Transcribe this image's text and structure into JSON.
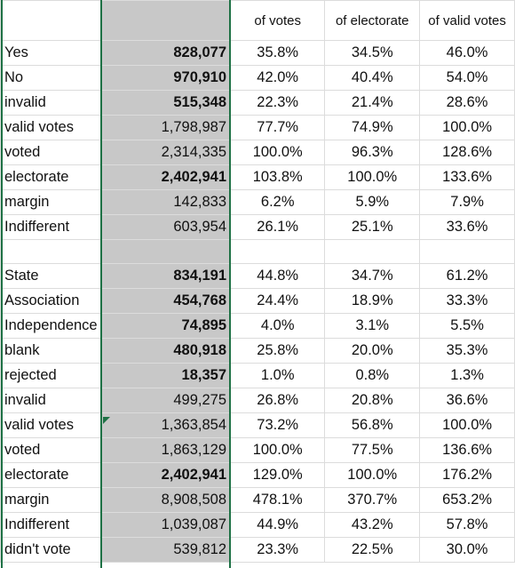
{
  "header": {
    "col_a": "",
    "col_b": "",
    "col_c": "of votes",
    "col_d": "of electorate",
    "col_e": "of valid votes"
  },
  "colors": {
    "selection_border": "#1e7145",
    "selected_fill": "#c8c8c8",
    "gridline": "#dcdcdc"
  },
  "rows": [
    {
      "label": "Yes",
      "value": "828,077",
      "bold": true,
      "of_votes": "35.8%",
      "of_electorate": "34.5%",
      "of_valid": "46.0%"
    },
    {
      "label": "No",
      "value": "970,910",
      "bold": true,
      "of_votes": "42.0%",
      "of_electorate": "40.4%",
      "of_valid": "54.0%"
    },
    {
      "label": "invalid",
      "value": "515,348",
      "bold": true,
      "of_votes": "22.3%",
      "of_electorate": "21.4%",
      "of_valid": "28.6%"
    },
    {
      "label": "valid votes",
      "value": "1,798,987",
      "bold": false,
      "of_votes": "77.7%",
      "of_electorate": "74.9%",
      "of_valid": "100.0%"
    },
    {
      "label": "voted",
      "value": "2,314,335",
      "bold": false,
      "of_votes": "100.0%",
      "of_electorate": "96.3%",
      "of_valid": "128.6%"
    },
    {
      "label": "electorate",
      "value": "2,402,941",
      "bold": true,
      "of_votes": "103.8%",
      "of_electorate": "100.0%",
      "of_valid": "133.6%"
    },
    {
      "label": "margin",
      "value": "142,833",
      "bold": false,
      "of_votes": "6.2%",
      "of_electorate": "5.9%",
      "of_valid": "7.9%"
    },
    {
      "label": "Indifferent",
      "value": "603,954",
      "bold": false,
      "of_votes": "26.1%",
      "of_electorate": "25.1%",
      "of_valid": "33.6%"
    },
    {
      "label": "",
      "value": "",
      "bold": false,
      "of_votes": "",
      "of_electorate": "",
      "of_valid": ""
    },
    {
      "label": "State",
      "value": "834,191",
      "bold": true,
      "of_votes": "44.8%",
      "of_electorate": "34.7%",
      "of_valid": "61.2%"
    },
    {
      "label": "Association",
      "value": "454,768",
      "bold": true,
      "of_votes": "24.4%",
      "of_electorate": "18.9%",
      "of_valid": "33.3%"
    },
    {
      "label": "Independence",
      "value": "74,895",
      "bold": true,
      "of_votes": "4.0%",
      "of_electorate": "3.1%",
      "of_valid": "5.5%"
    },
    {
      "label": "blank",
      "value": "480,918",
      "bold": true,
      "of_votes": "25.8%",
      "of_electorate": "20.0%",
      "of_valid": "35.3%"
    },
    {
      "label": "rejected",
      "value": "18,357",
      "bold": true,
      "of_votes": "1.0%",
      "of_electorate": "0.8%",
      "of_valid": "1.3%"
    },
    {
      "label": "invalid",
      "value": "499,275",
      "bold": false,
      "of_votes": "26.8%",
      "of_electorate": "20.8%",
      "of_valid": "36.6%"
    },
    {
      "label": "valid votes",
      "value": "1,363,854",
      "bold": false,
      "of_votes": "73.2%",
      "of_electorate": "56.8%",
      "of_valid": "100.0%"
    },
    {
      "label": "voted",
      "value": "1,863,129",
      "bold": false,
      "of_votes": "100.0%",
      "of_electorate": "77.5%",
      "of_valid": "136.6%"
    },
    {
      "label": "electorate",
      "value": "2,402,941",
      "bold": true,
      "of_votes": "129.0%",
      "of_electorate": "100.0%",
      "of_valid": "176.2%"
    },
    {
      "label": "margin",
      "value": "8,908,508",
      "bold": false,
      "of_votes": "478.1%",
      "of_electorate": "370.7%",
      "of_valid": "653.2%"
    },
    {
      "label": "Indifferent",
      "value": "1,039,087",
      "bold": false,
      "of_votes": "44.9%",
      "of_electorate": "43.2%",
      "of_valid": "57.8%"
    },
    {
      "label": "didn't vote",
      "value": "539,812",
      "bold": false,
      "of_votes": "23.3%",
      "of_electorate": "22.5%",
      "of_valid": "30.0%"
    }
  ]
}
